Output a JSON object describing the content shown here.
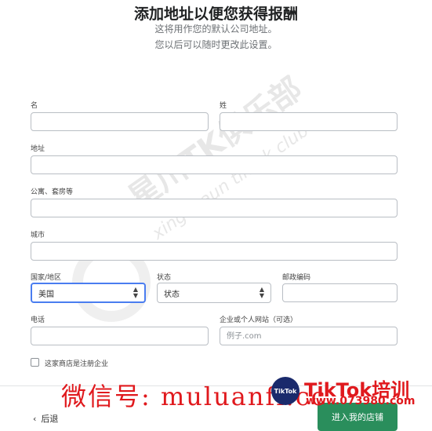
{
  "header": {
    "title": "添加地址以便您获得报酬",
    "subtitle_line1": "这将用作您的默认公司地址。",
    "subtitle_line2": "您以后可以随时更改此设置。"
  },
  "form": {
    "first_name_label": "名",
    "first_name_value": "",
    "last_name_label": "姓",
    "last_name_value": "",
    "address_label": "地址",
    "address_value": "",
    "apartment_label": "公寓、套房等",
    "apartment_value": "",
    "city_label": "城市",
    "city_value": "",
    "country_label": "国家/地区",
    "country_value": "美国",
    "state_label": "状态",
    "state_value": "状态",
    "zip_label": "邮政编码",
    "zip_value": "",
    "phone_label": "电话",
    "phone_value": "",
    "website_label": "企业或个人网站（可选）",
    "website_placeholder": "例子.com",
    "registered_checkbox_label": "这家商店是注册企业",
    "registered_checked": false
  },
  "footer": {
    "back_label": "后退",
    "enter_store_label": "进入我的店铺"
  },
  "watermark": {
    "diagonal_text": "星川TK俱乐部",
    "diagonal_sub": "xingchaun tiktok club",
    "bottom_text": "微信号: muluanfi.cc",
    "brand_logo": "TikTok",
    "brand_text": "TikTok培训",
    "brand_site": "www.073980.com"
  },
  "colors": {
    "primary_button": "#2a8e5c",
    "focus_border": "#4a7df0",
    "watermark_red": "#e0191d"
  }
}
